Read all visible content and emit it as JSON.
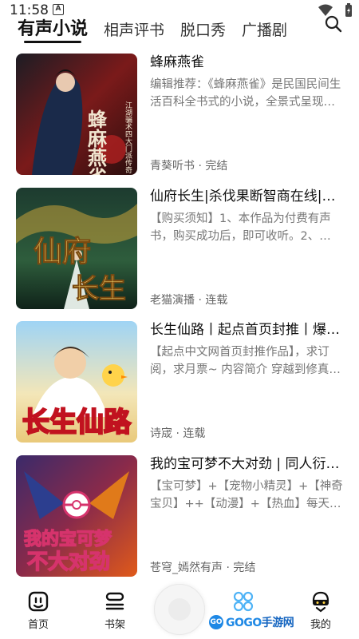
{
  "status": {
    "time": "11:58",
    "indicator": "A"
  },
  "tabs": [
    {
      "label": "有声小说"
    },
    {
      "label": "相声评书"
    },
    {
      "label": "脱口秀"
    },
    {
      "label": "广播剧"
    }
  ],
  "books": [
    {
      "title": "蜂麻燕雀",
      "desc": "编辑推荐：《蜂麻燕雀》是民国民间生活百科全书式的小说，全景式呈现…",
      "meta": "青葵听书 · 完结",
      "cover_text": "蜂麻燕雀",
      "cover_sub": "江湖骗术四大门派传奇"
    },
    {
      "title": "仙府长生|杀伐果断智商在线|…",
      "desc": "【购买须知】1、本作品为付费有声书，购买成功后，即可收听。2、…",
      "meta": "老猫演播 · 连载",
      "cover_text": "仙府长生"
    },
    {
      "title": "长生仙路丨起点首页封推丨爆…",
      "desc": "【起点中文网首页封推作品】，求订阅，求月票~ 内容简介 穿越到修真…",
      "meta": "诗宬 · 连载",
      "cover_text": "长生仙路"
    },
    {
      "title": "我的宝可梦不大对劲 | 同人衍…",
      "desc": "【宝可梦】+【宠物小精灵】+【神奇宝贝】++【动漫】+【热血】每天…",
      "meta": "苍穹_嫣然有声 · 完结",
      "cover_text": "我的宝可梦不大对劲"
    }
  ],
  "nav": {
    "home": "首页",
    "shelf": "书架",
    "discover": "",
    "mine": "我的"
  },
  "watermark": {
    "circle": "GO",
    "text": "GOGO",
    "cn": "手游网"
  }
}
